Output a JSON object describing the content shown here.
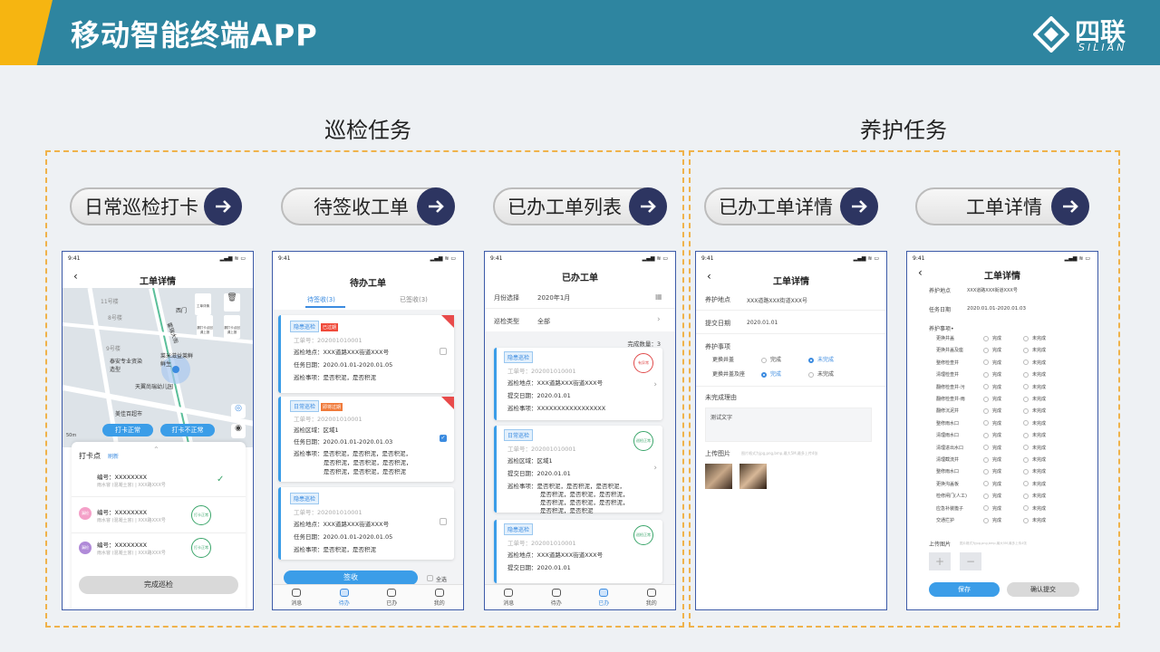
{
  "header": {
    "title": "移动智能终端APP",
    "logo_cn": "四联",
    "logo_en": "SILIAN"
  },
  "sections": {
    "inspection": "巡检任务",
    "maintenance": "养护任务"
  },
  "pills": [
    "日常巡检打卡",
    "待签收工单",
    "已办工单列表",
    "已办工单详情",
    "工单详情"
  ],
  "statusbar": {
    "time": "9:41",
    "icons": "▂▄▆ ≋ ▭"
  },
  "phone1": {
    "title": "工单详情",
    "map_labels": [
      "11号楼",
      "8号楼",
      "9号楼",
      "泰安专业资染造型",
      "菜米滋益莱鲜鲜生",
      "天翼尚瑞幼儿园",
      "美佳百超市",
      "西门",
      "霍瑞大街"
    ],
    "map_icons": [
      "工单详情",
      "漏打卡点回调上报",
      "漏打卡点回调上报"
    ],
    "scale": "50m",
    "btn_normal": "打卡正常",
    "btn_abnormal": "打卡不正常",
    "panel_title": "打卡点",
    "panel_refresh": "刷新",
    "points": [
      {
        "code": "编号：XXXXXXXX",
        "desc": "雨水窨 (混凝土窨) | XXX路XXX号"
      },
      {
        "code": "编号：XXXXXXXX",
        "desc": "雨水窨 (混凝土窨) | XXX路XXX号",
        "badge": "漏检"
      },
      {
        "code": "编号：XXXXXXXX",
        "desc": "雨水窨 (混凝土窨) | XXX路XXX号",
        "badge": "漏检"
      }
    ],
    "stamp": "打卡正常",
    "finish": "完成巡检"
  },
  "phone2": {
    "title": "待办工单",
    "tab_pending": "待签收(3)",
    "tab_signed": "已签收(3)",
    "cards": [
      {
        "tag": "隐患巡检",
        "badge": "已过期",
        "no": "工单号：202001010001",
        "l1": "巡检地点：XXX道路XXX街道XXX号",
        "l2": "任务日期：2020.01.01-2020.01.05",
        "l3": "巡检事项：是否积泥，是否积泥"
      },
      {
        "tag": "日常巡检",
        "badge": "即将过期",
        "no": "工单号：202001010001",
        "l1": "巡检区域：区域1",
        "l2": "任务日期：2020.01.01-2020.01.03",
        "l3": "巡检事项：是否积泥，是否积泥，是否积泥，",
        "l4": "是否积泥，是否积泥，是否积泥，",
        "l5": "是否积泥，是否积泥，是否积泥"
      },
      {
        "tag": "隐患巡检",
        "no": "工单号：202001010001",
        "l1": "巡检地点：XXX道路XXX街道XXX号",
        "l2": "任务日期：2020.01.01-2020.01.05",
        "l3": "巡检事项：是否积泥，是否积泥"
      }
    ],
    "sign": "签收",
    "select_all": "全选",
    "tabs": [
      "消息",
      "待办",
      "已办",
      "我的"
    ]
  },
  "phone3": {
    "title": "已办工单",
    "month_label": "月份选择",
    "month_value": "2020年1月",
    "type_label": "巡检类型",
    "type_value": "全部",
    "count": "完成数量：3",
    "cards": [
      {
        "tag": "隐患巡检",
        "no": "工单号：202001010001",
        "l1": "巡检地点：XXX道路XXX街道XXX号",
        "l2": "提交日期：2020.01.01",
        "l3": "巡检事项：XXXXXXXXXXXXXXXXX",
        "stamp": "有异常"
      },
      {
        "tag": "日常巡检",
        "no": "工单号：202001010001",
        "l1": "巡检区域：区域1",
        "l2": "提交日期：2020.01.01",
        "l3": "巡检事项：是否积泥，是否积泥，是否积泥，",
        "l4": "是否积泥，是否积泥，是否积泥，",
        "l5": "是否积泥，是否积泥，是否积泥，",
        "l6": "是否积泥，是否积泥",
        "stamp": "巡检正常"
      },
      {
        "tag": "隐患巡检",
        "no": "工单号：202001010001",
        "l1": "巡检地点：XXX道路XXX街道XXX号",
        "l2": "提交日期：2020.01.01",
        "stamp": "巡检正常"
      }
    ],
    "tabs": [
      "消息",
      "待办",
      "已办",
      "我的"
    ]
  },
  "phone4": {
    "title": "工单详情",
    "addr_label": "养护地点",
    "addr_value": "XXX道路XXX街道XXX号",
    "date_label": "提交日期",
    "date_value": "2020.01.01",
    "items_label": "养护事项",
    "item1": "更换井盖",
    "item2": "更换井盖及座",
    "done": "完成",
    "undone": "未完成",
    "reason_label": "未完成理由",
    "reason_text": "测试文字",
    "upload_label": "上传图片",
    "upload_hint": "图片格式为jpg,png,bmp,最大5M,最多上传4张"
  },
  "phone5": {
    "title": "工单详情",
    "addr_label": "养护地点",
    "addr_value": "XXX道路XXX街道XXX号",
    "date_label": "任务日期",
    "date_value": "2020.01.01-2020.01.03",
    "items_label": "养护事项•",
    "items": [
      "更换井盖",
      "更换井盖及座",
      "整修检查井",
      "清理检查井",
      "翻修检查井-污",
      "翻修检查井-雨",
      "翻修沉泥井",
      "整修雨水口",
      "清理雨水口",
      "清理进出水口",
      "清理截流井",
      "整修雨水口",
      "更换沟盖板",
      "检修闸门(人工)",
      "应急补装篦子",
      "交通拦护"
    ],
    "done": "完成",
    "undone": "未完成",
    "upload_label": "上传图片",
    "upload_hint": "图片格式为jpg,png,bmp,最大5M,最多上传4张",
    "save": "保存",
    "submit": "确认提交"
  }
}
